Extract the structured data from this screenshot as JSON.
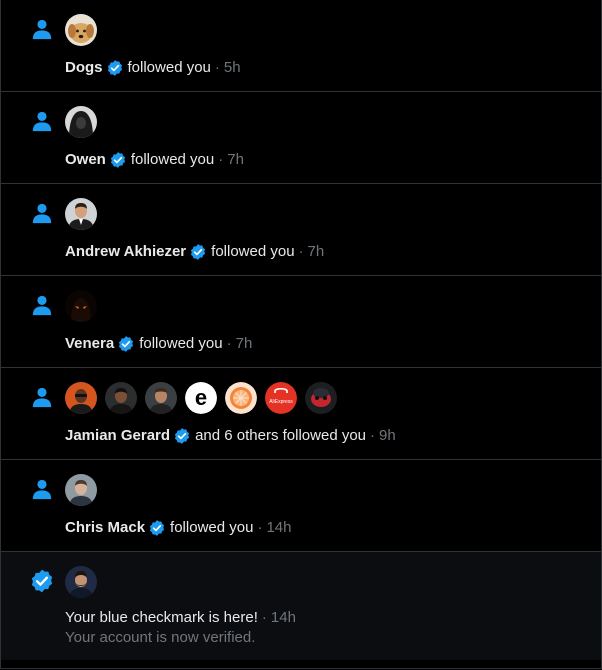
{
  "colors": {
    "accent": "#1d9bf0",
    "background": "#000000",
    "divider": "#2f3336",
    "text": "#e7e9ea",
    "muted": "#71767b"
  },
  "notifications": [
    {
      "icon": "person-icon",
      "name": "Dogs",
      "verified": true,
      "action": "followed you",
      "time": "5h"
    },
    {
      "icon": "person-icon",
      "name": "Owen",
      "verified": true,
      "action": "followed you",
      "time": "7h"
    },
    {
      "icon": "person-icon",
      "name": "Andrew Akhiezer",
      "verified": true,
      "action": "followed you",
      "time": "7h"
    },
    {
      "icon": "person-icon",
      "name": "Venera",
      "verified": true,
      "action": "followed you",
      "time": "7h"
    },
    {
      "icon": "person-icon",
      "name": "Jamian Gerard",
      "verified": true,
      "action": "and 6 others followed you",
      "time": "9h",
      "avatar_logo_letter": "e",
      "avatar_logo_brand": "AliExpress"
    },
    {
      "icon": "person-icon",
      "name": "Chris Mack",
      "verified": true,
      "action": "followed you",
      "time": "14h"
    },
    {
      "icon": "verified-badge-icon",
      "title": "Your blue checkmark is here!",
      "time": "14h",
      "subtitle": "Your account is now verified."
    }
  ],
  "separator": "·"
}
